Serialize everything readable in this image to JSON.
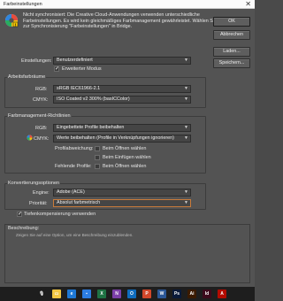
{
  "window": {
    "title": "Farbeinstellungen",
    "close_glyph": "✕"
  },
  "message": "Nicht synchronisiert: Die Creative Cloud-Anwendungen verwenden unterschiedliche Farbeinstellungen. Es wird kein gleichmäßiges Farbmanagement gewährleistet. Wählen Sie zur Synchronisierung \"Farbeinstellungen\" in Bridge.",
  "buttons": {
    "ok": "OK",
    "cancel": "Abbrechen",
    "load": "Laden...",
    "save": "Speichern..."
  },
  "settings": {
    "label": "Einstellungen:",
    "value": "Benutzerdefiniert",
    "advanced_mode": {
      "label": "Erweiterter Modus",
      "checked": true
    }
  },
  "workspaces": {
    "title": "Arbeitsfarbräume",
    "rgb": {
      "label": "RGB:",
      "value": "sRGB IEC61966-2.1"
    },
    "cmyk": {
      "label": "CMYK:",
      "value": "ISO Coated v2 300% (basICColor)"
    }
  },
  "policies": {
    "title": "Farbmanagement-Richtlinien",
    "rgb": {
      "label": "RGB:",
      "value": "Eingebettete Profile beibehalten"
    },
    "cmyk": {
      "label": "CMYK:",
      "value": "Werte beibehalten (Profile in Verknüpfungen ignorieren)"
    },
    "mismatch": {
      "label": "Profilabweichung:",
      "open": "Beim Öffnen wählen",
      "paste": "Beim Einfügen wählen",
      "open_checked": false,
      "paste_checked": false
    },
    "missing": {
      "label": "Fehlende Profile:",
      "open": "Beim Öffnen wählen",
      "open_checked": false
    }
  },
  "conversion": {
    "title": "Konvertierungsoptionen",
    "engine": {
      "label": "Engine:",
      "value": "Adobe (ACE)"
    },
    "intent": {
      "label": "Priorität:",
      "value": "Absolut farbmetrisch"
    }
  },
  "black_point": {
    "label": "Tiefenkompensierung verwenden",
    "checked": true
  },
  "description": {
    "title": "Beschreibung:",
    "text": "Zeigen Sie auf eine Option, um eine Beschreibung einzublenden."
  },
  "icons": {
    "warning": "warning-icon",
    "cmyk_warning": "cmyk-warning-icon",
    "dropdown": "chevron-down-icon"
  },
  "taskbar": {
    "apps": [
      {
        "name": "microphone-icon",
        "glyph": "🎙",
        "color": "#1e1e1e"
      },
      {
        "name": "file-explorer-icon",
        "glyph": "▭",
        "color": "#f2c744"
      },
      {
        "name": "edge-icon",
        "glyph": "e",
        "color": "#1e78d4"
      },
      {
        "name": "sticky-note-icon",
        "glyph": "▪",
        "color": "#2c7de1"
      },
      {
        "name": "excel-icon",
        "glyph": "X",
        "color": "#1f7244"
      },
      {
        "name": "onenote-icon",
        "glyph": "N",
        "color": "#7b3fa8"
      },
      {
        "name": "outlook-icon",
        "glyph": "O",
        "color": "#0f6cbd"
      },
      {
        "name": "powerpoint-icon",
        "glyph": "P",
        "color": "#d2472a"
      },
      {
        "name": "word-icon",
        "glyph": "W",
        "color": "#2b5797"
      },
      {
        "name": "photoshop-icon",
        "glyph": "Ps",
        "color": "#0a1a3a"
      },
      {
        "name": "illustrator-icon",
        "glyph": "Ai",
        "color": "#3a1a00"
      },
      {
        "name": "indesign-icon",
        "glyph": "Id",
        "color": "#3c0a1c"
      },
      {
        "name": "acrobat-icon",
        "glyph": "A",
        "color": "#b30b00"
      }
    ]
  }
}
